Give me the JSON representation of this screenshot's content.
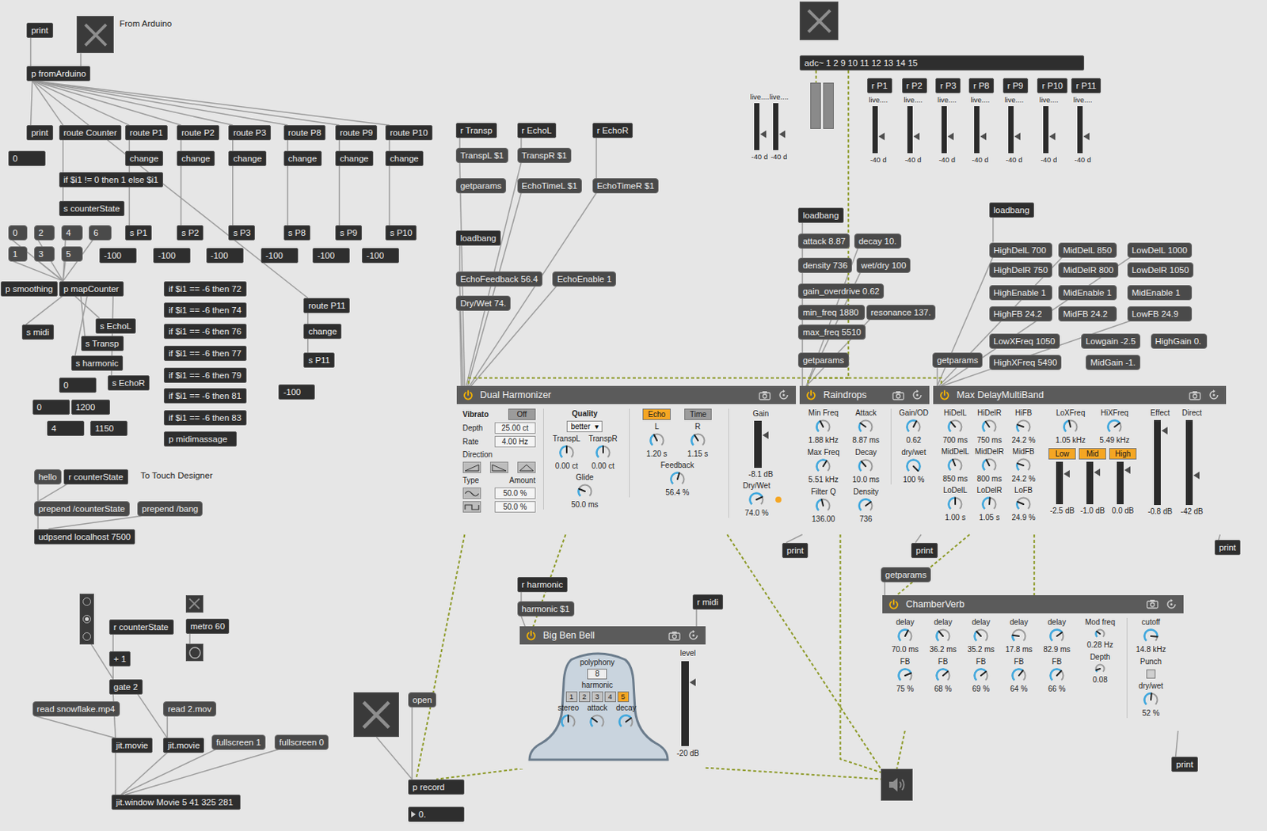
{
  "patcher": {
    "boxes": [
      {
        "text": "print",
        "kind": "object"
      },
      {
        "text": "From Arduino",
        "kind": "comment"
      },
      {
        "text": "p fromArduino",
        "kind": "object"
      },
      {
        "text": "print",
        "kind": "object"
      },
      {
        "text": "route Counter",
        "kind": "object"
      },
      {
        "text": "route P1",
        "kind": "object"
      },
      {
        "text": "route P2",
        "kind": "object"
      },
      {
        "text": "route P3",
        "kind": "object"
      },
      {
        "text": "route P8",
        "kind": "object"
      },
      {
        "text": "route P9",
        "kind": "object"
      },
      {
        "text": "route P10",
        "kind": "object"
      },
      {
        "text": "0",
        "kind": "number"
      },
      {
        "text": "change",
        "kind": "object"
      },
      {
        "text": "change",
        "kind": "object"
      },
      {
        "text": "change",
        "kind": "object"
      },
      {
        "text": "change",
        "kind": "object"
      },
      {
        "text": "change",
        "kind": "object"
      },
      {
        "text": "change",
        "kind": "object"
      },
      {
        "text": "if $i1 != 0 then 1 else $i1",
        "kind": "object"
      },
      {
        "text": "s counterState",
        "kind": "object"
      },
      {
        "text": "0",
        "kind": "message"
      },
      {
        "text": "2",
        "kind": "message"
      },
      {
        "text": "4",
        "kind": "message"
      },
      {
        "text": "6",
        "kind": "message"
      },
      {
        "text": "1",
        "kind": "message"
      },
      {
        "text": "3",
        "kind": "message"
      },
      {
        "text": "5",
        "kind": "message"
      },
      {
        "text": "s P1",
        "kind": "object"
      },
      {
        "text": "s P2",
        "kind": "object"
      },
      {
        "text": "s P3",
        "kind": "object"
      },
      {
        "text": "s P8",
        "kind": "object"
      },
      {
        "text": "s P9",
        "kind": "object"
      },
      {
        "text": "s P10",
        "kind": "object"
      },
      {
        "text": "-100",
        "kind": "number"
      },
      {
        "text": "-100",
        "kind": "number"
      },
      {
        "text": "-100",
        "kind": "number"
      },
      {
        "text": "-100",
        "kind": "number"
      },
      {
        "text": "-100",
        "kind": "number"
      },
      {
        "text": "-100",
        "kind": "number"
      },
      {
        "text": "p smoothing",
        "kind": "object"
      },
      {
        "text": "p mapCounter",
        "kind": "object"
      },
      {
        "text": "if $i1 == -6 then 72",
        "kind": "object"
      },
      {
        "text": "if $i1 == -6 then 74",
        "kind": "object"
      },
      {
        "text": "if $i1 == -6 then 76",
        "kind": "object"
      },
      {
        "text": "if $i1 == -6 then 77",
        "kind": "object"
      },
      {
        "text": "if $i1 == -6 then 79",
        "kind": "object"
      },
      {
        "text": "if $i1 == -6 then 81",
        "kind": "object"
      },
      {
        "text": "if $i1 == -6 then 83",
        "kind": "object"
      },
      {
        "text": "p midimassage",
        "kind": "object"
      },
      {
        "text": "route P11",
        "kind": "object"
      },
      {
        "text": "change",
        "kind": "object"
      },
      {
        "text": "s P11",
        "kind": "object"
      },
      {
        "text": "-100",
        "kind": "number"
      },
      {
        "text": "s midi",
        "kind": "object"
      },
      {
        "text": "s EchoL",
        "kind": "object"
      },
      {
        "text": "s Transp",
        "kind": "object"
      },
      {
        "text": "s harmonic",
        "kind": "object"
      },
      {
        "text": "s EchoR",
        "kind": "object"
      },
      {
        "text": "0",
        "kind": "number"
      },
      {
        "text": "0",
        "kind": "number"
      },
      {
        "text": "1200",
        "kind": "number"
      },
      {
        "text": "4",
        "kind": "number"
      },
      {
        "text": "1150",
        "kind": "number"
      },
      {
        "text": "hello",
        "kind": "message"
      },
      {
        "text": "r counterState",
        "kind": "object"
      },
      {
        "text": "To Touch Designer",
        "kind": "comment"
      },
      {
        "text": "prepend /counterState",
        "kind": "message"
      },
      {
        "text": "prepend /bang",
        "kind": "message"
      },
      {
        "text": "udpsend localhost 7500",
        "kind": "object"
      },
      {
        "text": "r counterState",
        "kind": "object"
      },
      {
        "text": "metro 60",
        "kind": "object"
      },
      {
        "text": "+ 1",
        "kind": "object"
      },
      {
        "text": "gate 2",
        "kind": "object"
      },
      {
        "text": "read snowflake.mp4",
        "kind": "message"
      },
      {
        "text": "read 2.mov",
        "kind": "message"
      },
      {
        "text": "jit.movie",
        "kind": "object"
      },
      {
        "text": "jit.movie",
        "kind": "object"
      },
      {
        "text": "fullscreen 1",
        "kind": "message"
      },
      {
        "text": "fullscreen 0",
        "kind": "message"
      },
      {
        "text": "jit.window Movie 5 41 325 281",
        "kind": "object"
      },
      {
        "text": "r Transp",
        "kind": "object"
      },
      {
        "text": "r EchoL",
        "kind": "object"
      },
      {
        "text": "r EchoR",
        "kind": "object"
      },
      {
        "text": "TranspL $1",
        "kind": "message"
      },
      {
        "text": "TranspR $1",
        "kind": "message"
      },
      {
        "text": "getparams",
        "kind": "message"
      },
      {
        "text": "EchoTimeL $1",
        "kind": "message"
      },
      {
        "text": "EchoTimeR $1",
        "kind": "message"
      },
      {
        "text": "loadbang",
        "kind": "object"
      },
      {
        "text": "EchoFeedback 56.4",
        "kind": "message"
      },
      {
        "text": "EchoEnable 1",
        "kind": "message"
      },
      {
        "text": "Dry/Wet 74.",
        "kind": "message"
      },
      {
        "text": "r harmonic",
        "kind": "object"
      },
      {
        "text": "harmonic $1",
        "kind": "message"
      },
      {
        "text": "r midi",
        "kind": "object"
      },
      {
        "text": "open",
        "kind": "message"
      },
      {
        "text": "p record",
        "kind": "object"
      },
      {
        "text": "0.",
        "kind": "flonum"
      },
      {
        "text": "r P1",
        "kind": "object"
      },
      {
        "text": "r P2",
        "kind": "object"
      },
      {
        "text": "r P3",
        "kind": "object"
      },
      {
        "text": "r P8",
        "kind": "object"
      },
      {
        "text": "r P9",
        "kind": "object"
      },
      {
        "text": "r P10",
        "kind": "object"
      },
      {
        "text": "r P11",
        "kind": "object"
      },
      {
        "text": "loadbang",
        "kind": "object"
      },
      {
        "text": "attack 8.87",
        "kind": "message"
      },
      {
        "text": "decay 10.",
        "kind": "message"
      },
      {
        "text": "density 736",
        "kind": "message"
      },
      {
        "text": "wet/dry 100",
        "kind": "message"
      },
      {
        "text": "gain_overdrive 0.62",
        "kind": "message"
      },
      {
        "text": "min_freq 1880",
        "kind": "message"
      },
      {
        "text": "resonance 137.",
        "kind": "message"
      },
      {
        "text": "max_freq 5510",
        "kind": "message"
      },
      {
        "text": "getparams",
        "kind": "message"
      },
      {
        "text": "loadbang",
        "kind": "object"
      },
      {
        "text": "HighDelL 700",
        "kind": "message"
      },
      {
        "text": "MidDelL 850",
        "kind": "message"
      },
      {
        "text": "LowDelL 1000",
        "kind": "message"
      },
      {
        "text": "HighDelR 750",
        "kind": "message"
      },
      {
        "text": "MidDelR 800",
        "kind": "message"
      },
      {
        "text": "LowDelR 1050",
        "kind": "message"
      },
      {
        "text": "HighEnable 1",
        "kind": "message"
      },
      {
        "text": "MidEnable 1",
        "kind": "message"
      },
      {
        "text": "MidEnable 1",
        "kind": "message"
      },
      {
        "text": "HighFB 24.2",
        "kind": "message"
      },
      {
        "text": "MidFB 24.2",
        "kind": "message"
      },
      {
        "text": "LowFB 24.9",
        "kind": "message"
      },
      {
        "text": "LowXFreq 1050",
        "kind": "message"
      },
      {
        "text": "Lowgain -2.5",
        "kind": "message"
      },
      {
        "text": "HighGain 0.",
        "kind": "message"
      },
      {
        "text": "getparams",
        "kind": "message"
      },
      {
        "text": "HighXFreq 5490",
        "kind": "message"
      },
      {
        "text": "MidGain -1.",
        "kind": "message"
      },
      {
        "text": "getparams",
        "kind": "message"
      },
      {
        "text": "print",
        "kind": "object"
      },
      {
        "text": "print",
        "kind": "object"
      },
      {
        "text": "print",
        "kind": "object"
      },
      {
        "text": "print",
        "kind": "object"
      },
      {
        "text": "adc~ 1 2 9 10 11 12 13 14 15",
        "kind": "object"
      }
    ],
    "toggles": [
      {
        "on": false
      },
      {
        "on": false
      },
      {
        "on": false
      },
      {
        "on": false
      }
    ],
    "bang": {
      "active": false
    },
    "radio": [
      {
        "selected": false
      },
      {
        "selected": true
      },
      {
        "selected": false
      }
    ],
    "speaker": {
      "on": false
    },
    "signal_meters": [
      {
        "level": 0
      },
      {
        "level": 0
      }
    ],
    "gains": [
      {
        "label": "live....",
        "reading": "-40 d",
        "level": 0.35
      },
      {
        "label": "live....",
        "reading": "-40 d",
        "level": 0.35
      },
      {
        "label": "live....",
        "reading": "-40 d",
        "level": 0.35
      },
      {
        "label": "live....",
        "reading": "-40 d",
        "level": 0.35
      },
      {
        "label": "live....",
        "reading": "-40 d",
        "level": 0.35
      },
      {
        "label": "live....",
        "reading": "-40 d",
        "level": 0.35
      },
      {
        "label": "live....",
        "reading": "-40 d",
        "level": 0.35
      },
      {
        "label": "live....",
        "reading": "-40 d",
        "level": 0.35
      },
      {
        "label": "live....",
        "reading": "-40 d",
        "level": 0.35
      }
    ]
  },
  "devices": {
    "harmonizer": {
      "title": "Dual Harmonizer",
      "on": true,
      "vibrato": {
        "label": "Vibrato",
        "toggle": "Off",
        "on": false
      },
      "depth": {
        "label": "Depth",
        "value": "25.00 ct"
      },
      "rate": {
        "label": "Rate",
        "value": "4.00 Hz"
      },
      "direction": {
        "label": "Direction",
        "options": [
          {
            "selected": false
          },
          {
            "selected": false
          },
          {
            "selected": false
          }
        ]
      },
      "type_label": "Type",
      "amount_label": "Amount",
      "amounts": [
        {
          "value": "50.0 %",
          "kind": "sine"
        },
        {
          "value": "50.0 %",
          "kind": "square"
        }
      ],
      "quality": {
        "label": "Quality",
        "value": "better",
        "arrow": "▾"
      },
      "transp": [
        {
          "label": "TranspL",
          "value": "0.00 ct",
          "level": 0.5
        },
        {
          "label": "TranspR",
          "value": "0.00 ct",
          "level": 0.5
        }
      ],
      "glide": {
        "label": "Glide",
        "value": "50.0 ms",
        "level": 0.25
      },
      "modes": [
        {
          "label": "Echo",
          "on": true
        },
        {
          "label": "Time",
          "on": false
        }
      ],
      "echo": [
        {
          "label": "L",
          "value": "1.20 s",
          "level": 0.4
        },
        {
          "label": "R",
          "value": "1.15 s",
          "level": 0.38
        }
      ],
      "feedback": {
        "label": "Feedback",
        "value": "56.4 %",
        "level": 0.56
      },
      "gain": {
        "label": "Gain",
        "reading": "-8.1 dB",
        "level": 0.7
      },
      "drywet": {
        "label": "Dry/Wet",
        "value": "74.0 %",
        "level": 0.74,
        "modulated": true
      }
    },
    "raindrops": {
      "title": "Raindrops",
      "on": true,
      "columns": [
        [
          {
            "label": "Min Freq",
            "value": "1.88 kHz",
            "level": 0.4
          },
          {
            "label": "Max Freq",
            "value": "5.51 kHz",
            "level": 0.62
          },
          {
            "label": "Filter Q",
            "value": "136.00",
            "level": 0.45
          }
        ],
        [
          {
            "label": "Attack",
            "value": "8.87 ms",
            "level": 0.3
          },
          {
            "label": "Decay",
            "value": "10.0 ms",
            "level": 0.35
          },
          {
            "label": "Density",
            "value": "736",
            "level": 0.7
          }
        ],
        [
          {
            "label": "Gain/OD",
            "value": "0.62",
            "level": 0.6
          },
          {
            "label": "dry/wet",
            "value": "100 %",
            "level": 1
          }
        ]
      ]
    },
    "delay": {
      "title": "Max DelayMultiBand",
      "on": true,
      "knobs": [
        {
          "label": "HiDelL",
          "value": "700 ms",
          "level": 0.35
        },
        {
          "label": "HiDelR",
          "value": "750 ms",
          "level": 0.37
        },
        {
          "label": "HiFB",
          "value": "24.2 %",
          "level": 0.24
        },
        {
          "label": "MidDelL",
          "value": "850 ms",
          "level": 0.42
        },
        {
          "label": "MidDelR",
          "value": "800 ms",
          "level": 0.4
        },
        {
          "label": "MidFB",
          "value": "24.2 %",
          "level": 0.24
        },
        {
          "label": "LoDelL",
          "value": "1.00 s",
          "level": 0.5
        },
        {
          "label": "LoDelR",
          "value": "1.05 s",
          "level": 0.52
        },
        {
          "label": "LoFB",
          "value": "24.9 %",
          "level": 0.25
        }
      ],
      "xfreq": [
        {
          "label": "LoXFreq",
          "value": "1.05 kHz",
          "level": 0.45
        },
        {
          "label": "HiXFreq",
          "value": "5.49 kHz",
          "level": 0.7
        }
      ],
      "bands": [
        {
          "label": "Low",
          "on": true,
          "reading": "-2.5 dB",
          "level": 0.72
        },
        {
          "label": "Mid",
          "on": true,
          "reading": "-1.0 dB",
          "level": 0.76
        },
        {
          "label": "High",
          "on": true,
          "reading": "0.0 dB",
          "level": 0.8
        }
      ],
      "outputs": [
        {
          "label": "Effect",
          "reading": "-0.8 dB",
          "level": 0.88
        },
        {
          "label": "Direct",
          "reading": "-42 dB",
          "level": 0.35
        }
      ]
    },
    "chamberverb": {
      "title": "ChamberVerb",
      "on": true,
      "lines": [
        {
          "delay_label": "delay",
          "delay": "70.0 ms",
          "delay_level": 0.6,
          "fb_label": "FB",
          "fb": "75 %",
          "fb_level": 0.75
        },
        {
          "delay_label": "delay",
          "delay": "36.2 ms",
          "delay_level": 0.35,
          "fb_label": "FB",
          "fb": "68 %",
          "fb_level": 0.68
        },
        {
          "delay_label": "delay",
          "delay": "35.2 ms",
          "delay_level": 0.34,
          "fb_label": "FB",
          "fb": "69 %",
          "fb_level": 0.69
        },
        {
          "delay_label": "delay",
          "delay": "17.8 ms",
          "delay_level": 0.2,
          "fb_label": "FB",
          "fb": "64 %",
          "fb_level": 0.64
        },
        {
          "delay_label": "delay",
          "delay": "82.9 ms",
          "delay_level": 0.7,
          "fb_label": "FB",
          "fb": "66 %",
          "fb_level": 0.66
        }
      ],
      "mod": {
        "label": "Mod freq",
        "value": "0.28 Hz",
        "level": 0.3
      },
      "depth": {
        "label": "Depth",
        "value": "0.08",
        "level": 0.1
      },
      "cutoff": {
        "label": "cutoff",
        "value": "14.8 kHz",
        "level": 0.85
      },
      "punch": {
        "label": "Punch",
        "checked": false
      },
      "drywet": {
        "label": "dry/wet",
        "value": "52 %",
        "level": 0.52
      }
    },
    "bigben": {
      "title": "Big Ben Bell",
      "on": true,
      "polyphony": {
        "label": "polyphony",
        "value": "8"
      },
      "harmonic": {
        "label": "harmonic",
        "options": [
          {
            "label": "1",
            "selected": false
          },
          {
            "label": "2",
            "selected": false
          },
          {
            "label": "3",
            "selected": false
          },
          {
            "label": "4",
            "selected": false
          },
          {
            "label": "5",
            "selected": true
          }
        ]
      },
      "knobs": [
        {
          "label": "stereo",
          "level": 0.5
        },
        {
          "label": "attack",
          "level": 0.3
        },
        {
          "label": "decay",
          "level": 0.7
        }
      ],
      "level": {
        "label": "level",
        "reading": "-20 dB",
        "level": 0.75
      }
    }
  }
}
